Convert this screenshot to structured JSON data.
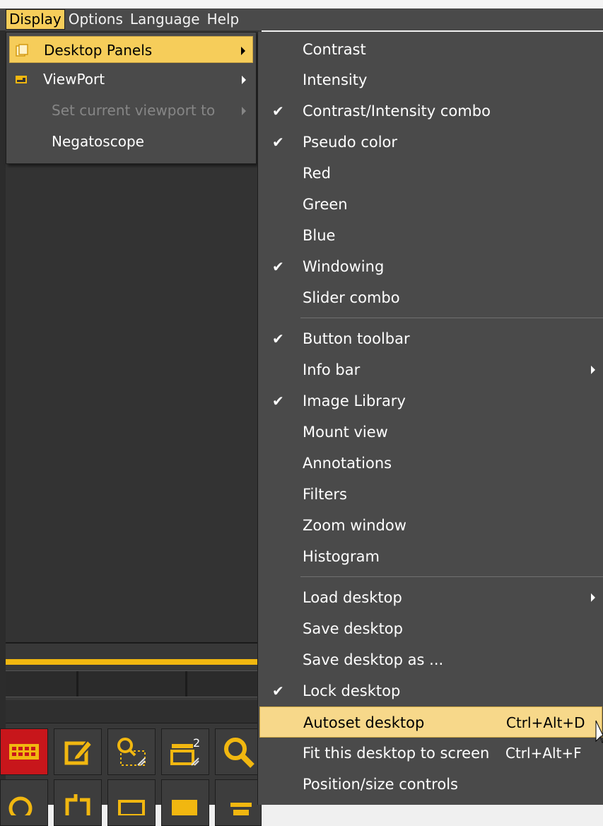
{
  "menubar": {
    "items": [
      "Display",
      "Options",
      "Language",
      "Help"
    ]
  },
  "display_menu": {
    "items": [
      {
        "label": "Desktop Panels",
        "icon": "desktop-panels-icon",
        "submenu": true,
        "highlighted": true
      },
      {
        "label": "ViewPort",
        "icon": "viewport-icon",
        "submenu": true
      },
      {
        "label": "Set current viewport to",
        "submenu": true,
        "disabled": true
      },
      {
        "label": "Negatoscope"
      }
    ]
  },
  "desktop_panels_menu": {
    "items": [
      {
        "label": "Contrast",
        "checked": false
      },
      {
        "label": "Intensity",
        "checked": false
      },
      {
        "label": "Contrast/Intensity combo",
        "checked": true
      },
      {
        "label": "Pseudo color",
        "checked": true
      },
      {
        "label": "Red",
        "checked": false
      },
      {
        "label": "Green",
        "checked": false
      },
      {
        "label": "Blue",
        "checked": false
      },
      {
        "label": "Windowing",
        "checked": true
      },
      {
        "label": "Slider combo",
        "checked": false
      },
      {
        "label": "Button toolbar",
        "checked": true
      },
      {
        "label": "Info bar",
        "checked": false,
        "submenu": true
      },
      {
        "label": "Image Library",
        "checked": true
      },
      {
        "label": "Mount view",
        "checked": false
      },
      {
        "label": "Annotations",
        "checked": false
      },
      {
        "label": "Filters",
        "checked": false
      },
      {
        "label": "Zoom window",
        "checked": false
      },
      {
        "label": "Histogram",
        "checked": false
      },
      {
        "label": "Load desktop",
        "checked": false,
        "submenu": true
      },
      {
        "label": "Save desktop",
        "checked": false
      },
      {
        "label": "Save desktop as ...",
        "checked": false
      },
      {
        "label": "Lock desktop",
        "checked": true
      },
      {
        "label": "Autoset desktop",
        "shortcut": "Ctrl+Alt+D",
        "highlighted": true
      },
      {
        "label": "Fit this desktop to screen",
        "shortcut": "Ctrl+Alt+F"
      },
      {
        "label": "Position/size controls"
      }
    ]
  },
  "checkmark_glyph": "✔",
  "colors": {
    "menu_bg": "#4a4a4a",
    "highlight": "#f6cd5a",
    "accent_yellow": "#f1b710"
  }
}
